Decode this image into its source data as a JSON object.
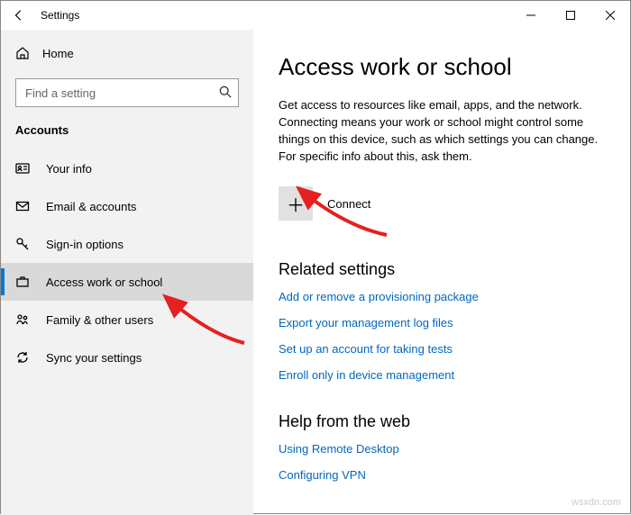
{
  "window": {
    "title": "Settings"
  },
  "sidebar": {
    "home": "Home",
    "search_placeholder": "Find a setting",
    "section": "Accounts",
    "items": [
      {
        "label": "Your info"
      },
      {
        "label": "Email & accounts"
      },
      {
        "label": "Sign-in options"
      },
      {
        "label": "Access work or school"
      },
      {
        "label": "Family & other users"
      },
      {
        "label": "Sync your settings"
      }
    ]
  },
  "main": {
    "heading": "Access work or school",
    "description": "Get access to resources like email, apps, and the network. Connecting means your work or school might control some things on this device, such as which settings you can change. For specific info about this, ask them.",
    "connect_label": "Connect",
    "related_heading": "Related settings",
    "related_links": [
      "Add or remove a provisioning package",
      "Export your management log files",
      "Set up an account for taking tests",
      "Enroll only in device management"
    ],
    "help_heading": "Help from the web",
    "help_links": [
      "Using Remote Desktop",
      "Configuring VPN"
    ]
  },
  "watermark": "wsxdn.com"
}
